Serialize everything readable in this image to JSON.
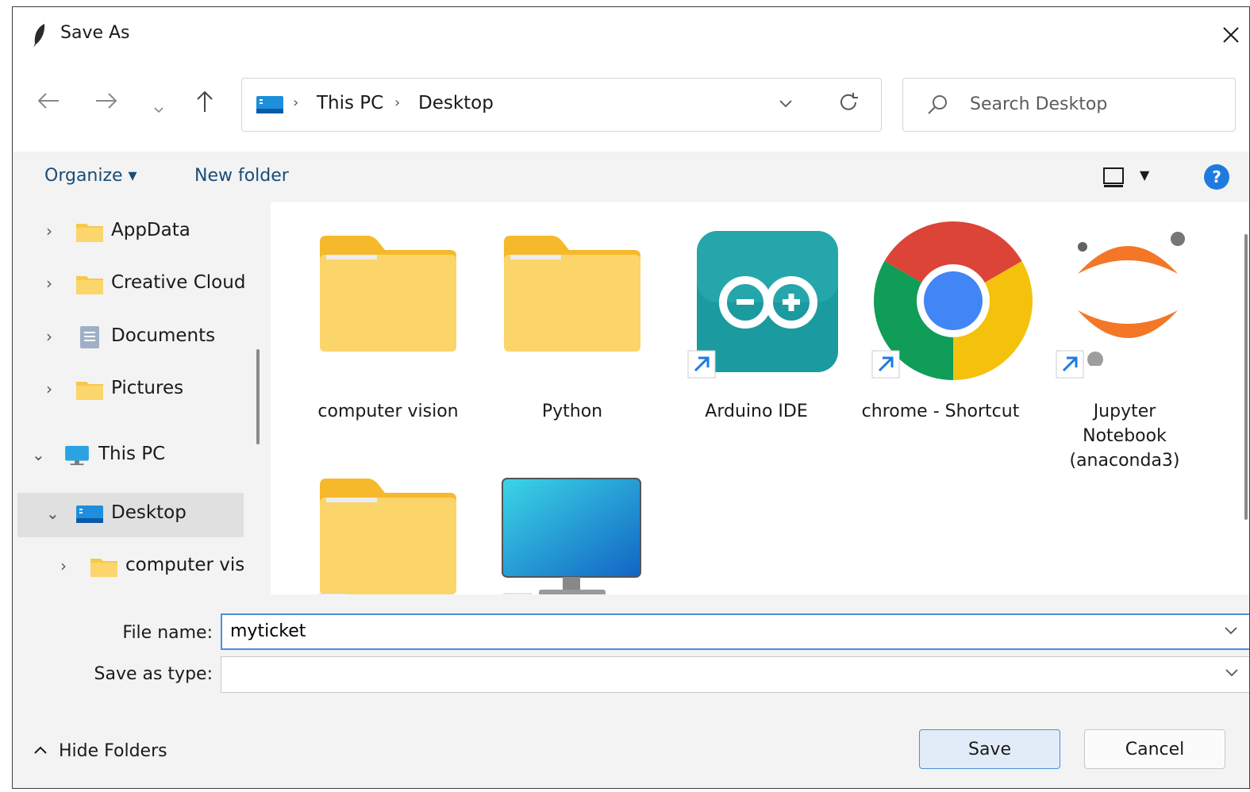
{
  "window": {
    "title": "Save As"
  },
  "nav": {
    "crumbs": [
      "This PC",
      "Desktop"
    ],
    "search_placeholder": "Search Desktop"
  },
  "cmd": {
    "organize": "Organize ▾",
    "new_folder": "New folder"
  },
  "sidebar": {
    "items": [
      {
        "label": "AppData"
      },
      {
        "label": "Creative Cloud"
      },
      {
        "label": "Documents"
      },
      {
        "label": "Pictures"
      },
      {
        "label": "This PC"
      },
      {
        "label": "Desktop"
      },
      {
        "label": "computer visi"
      }
    ]
  },
  "content": {
    "items": [
      {
        "label": "computer vision"
      },
      {
        "label": "Python"
      },
      {
        "label": "Arduino IDE"
      },
      {
        "label": "chrome - Shortcut"
      },
      {
        "label": "Jupyter Notebook (anaconda3)"
      }
    ]
  },
  "footer": {
    "file_name_label": "File name:",
    "file_name_value": "myticket",
    "save_type_label": "Save as type:",
    "hide_folders": "Hide Folders",
    "save": "Save",
    "cancel": "Cancel"
  },
  "colors": {
    "accent": "#4a90d9",
    "folder": "#f9c84a",
    "help": "#1e7ae0"
  }
}
